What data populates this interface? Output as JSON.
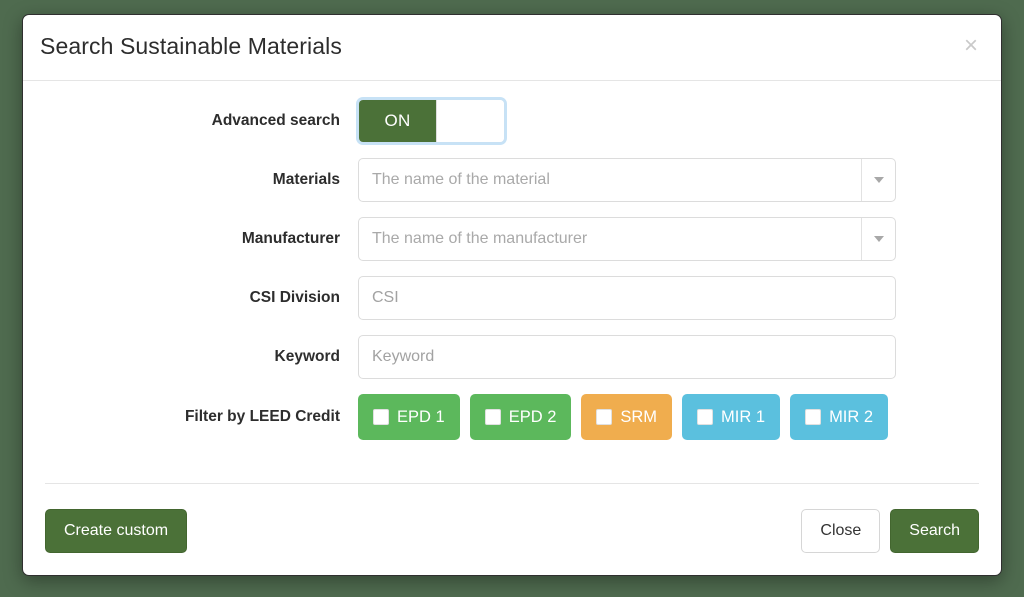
{
  "modal": {
    "title": "Search Sustainable Materials",
    "close_icon": "×"
  },
  "form": {
    "advanced_search": {
      "label": "Advanced search",
      "toggle_state": "ON"
    },
    "materials": {
      "label": "Materials",
      "placeholder": "The name of the material",
      "value": ""
    },
    "manufacturer": {
      "label": "Manufacturer",
      "placeholder": "The name of the manufacturer",
      "value": ""
    },
    "csi_division": {
      "label": "CSI Division",
      "placeholder": "CSI",
      "value": ""
    },
    "keyword": {
      "label": "Keyword",
      "placeholder": "Keyword",
      "value": ""
    },
    "leed_filter": {
      "label": "Filter by LEED Credit",
      "options": [
        {
          "label": "EPD 1",
          "color": "#5cb85c",
          "checked": false
        },
        {
          "label": "EPD 2",
          "color": "#5cb85c",
          "checked": false
        },
        {
          "label": "SRM",
          "color": "#f0ad4e",
          "checked": false
        },
        {
          "label": "MIR 1",
          "color": "#5bc0de",
          "checked": false
        },
        {
          "label": "MIR 2",
          "color": "#5bc0de",
          "checked": false
        }
      ]
    }
  },
  "footer": {
    "create_custom_label": "Create custom",
    "close_label": "Close",
    "search_label": "Search"
  },
  "colors": {
    "page_background": "#4f6b4f",
    "primary_green": "#4b7138",
    "success_green": "#5cb85c",
    "warning_orange": "#f0ad4e",
    "info_blue": "#5bc0de",
    "focus_blue": "#82beeb"
  }
}
